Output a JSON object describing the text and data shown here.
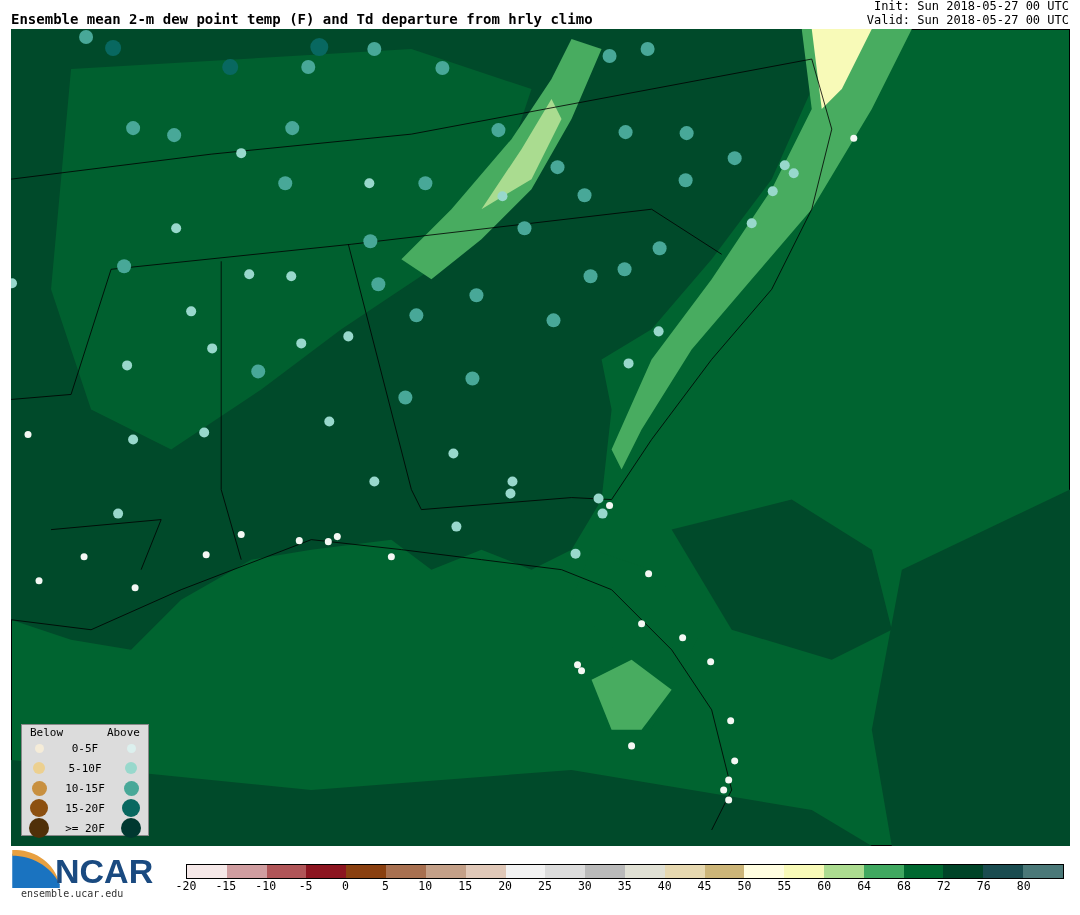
{
  "title": "Ensemble mean 2-m dew point temp (F) and Td departure from hrly climo",
  "init": "Init: Sun 2018-05-27 00 UTC",
  "valid": "Valid: Sun 2018-05-27 00 UTC",
  "legend": {
    "below_heading": "Below",
    "above_heading": "Above",
    "rows": [
      {
        "label": "0-5F",
        "below": {
          "color": "#f5ecd8"
        },
        "above": {
          "color": "#dcf0ee"
        }
      },
      {
        "label": "5-10F",
        "below": {
          "color": "#ecd090"
        },
        "above": {
          "color": "#98d8cc"
        }
      },
      {
        "label": "10-15F",
        "below": {
          "color": "#c89040"
        },
        "above": {
          "color": "#48a898"
        }
      },
      {
        "label": "15-20F",
        "below": {
          "color": "#8c5010"
        },
        "above": {
          "color": "#086860"
        }
      },
      {
        "label": ">= 20F",
        "below": {
          "color": "#503008"
        },
        "above": {
          "color": "#003830"
        }
      }
    ]
  },
  "logo": {
    "text": "NCAR",
    "url": "ensemble.ucar.edu"
  },
  "colorbar": {
    "segments": [
      {
        "color": "#f5e8e8"
      },
      {
        "color": "#d09da0"
      },
      {
        "color": "#b05558"
      },
      {
        "color": "#8c1520"
      },
      {
        "color": "#8a4010"
      },
      {
        "color": "#a87050"
      },
      {
        "color": "#c4a088"
      },
      {
        "color": "#e0c8b8"
      },
      {
        "color": "#f2f2f2"
      },
      {
        "color": "#dcdcdc"
      },
      {
        "color": "#bababa"
      },
      {
        "color": "#e0e0d4"
      },
      {
        "color": "#e6d8b0"
      },
      {
        "color": "#ccb578"
      },
      {
        "color": "#fffde0"
      },
      {
        "color": "#f8fab8"
      },
      {
        "color": "#acdc90"
      },
      {
        "color": "#40a860"
      },
      {
        "color": "#006830"
      },
      {
        "color": "#004428"
      },
      {
        "color": "#1a4c50"
      },
      {
        "color": "#4a7878"
      }
    ],
    "ticks": [
      "-20",
      "-15",
      "-10",
      "-5",
      "0",
      "5",
      "10",
      "15",
      "20",
      "25",
      "30",
      "35",
      "40",
      "45",
      "50",
      "55",
      "60",
      "64",
      "68",
      "72",
      "76",
      "80"
    ]
  }
}
